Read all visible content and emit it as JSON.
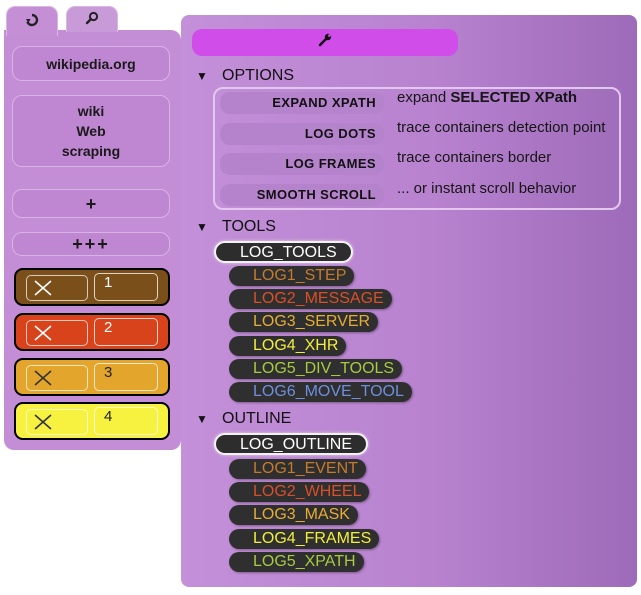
{
  "tabs": [
    {
      "icon": "recycle-icon",
      "glyph": "♻"
    },
    {
      "icon": "magnifier-icon",
      "glyph": "⌕"
    }
  ],
  "left": {
    "domain": "wikipedia.org",
    "wiki_lines": [
      "wiki",
      "Web",
      "scraping"
    ],
    "plus_label": "+",
    "plus3_label": "+++",
    "slots": [
      {
        "num": "1",
        "color": "#7b4f1a"
      },
      {
        "num": "2",
        "color": "#d8431c"
      },
      {
        "num": "3",
        "color": "#e3a52c"
      },
      {
        "num": "4",
        "color": "#f6f23f"
      }
    ]
  },
  "toolbar": {
    "icon": "wrench-icon"
  },
  "options": {
    "header": "OPTIONS",
    "items": [
      {
        "label": "EXPAND XPATH",
        "desc_prefix": "expand ",
        "desc_bold": "SELECTED XPath"
      },
      {
        "label": "LOG DOTS",
        "desc": "trace containers detection point"
      },
      {
        "label": "LOG FRAMES",
        "desc": "trace containers border"
      },
      {
        "label": "SMOOTH SCROLL",
        "desc": "... or instant scroll behavior"
      }
    ]
  },
  "tools": {
    "header": "TOOLS",
    "main": "LOG_TOOLS",
    "items": [
      {
        "label": "LOG1_STEP",
        "color": "#c37b2e"
      },
      {
        "label": "LOG2_MESSAGE",
        "color": "#d8502a"
      },
      {
        "label": "LOG3_SERVER",
        "color": "#e6ad36"
      },
      {
        "label": "LOG4_XHR",
        "color": "#f2ee3c"
      },
      {
        "label": "LOG5_DIV_TOOLS",
        "color": "#a7c944"
      },
      {
        "label": "LOG6_MOVE_TOOL",
        "color": "#6f8ede"
      }
    ]
  },
  "outline": {
    "header": "OUTLINE",
    "main": "LOG_OUTLINE",
    "items": [
      {
        "label": "LOG1_EVENT",
        "color": "#c37b2e"
      },
      {
        "label": "LOG2_WHEEL",
        "color": "#d8502a"
      },
      {
        "label": "LOG3_MASK",
        "color": "#e6ad36"
      },
      {
        "label": "LOG4_FRAMES",
        "color": "#f2ee3c"
      },
      {
        "label": "LOG5_XPATH",
        "color": "#a7c944"
      }
    ]
  }
}
